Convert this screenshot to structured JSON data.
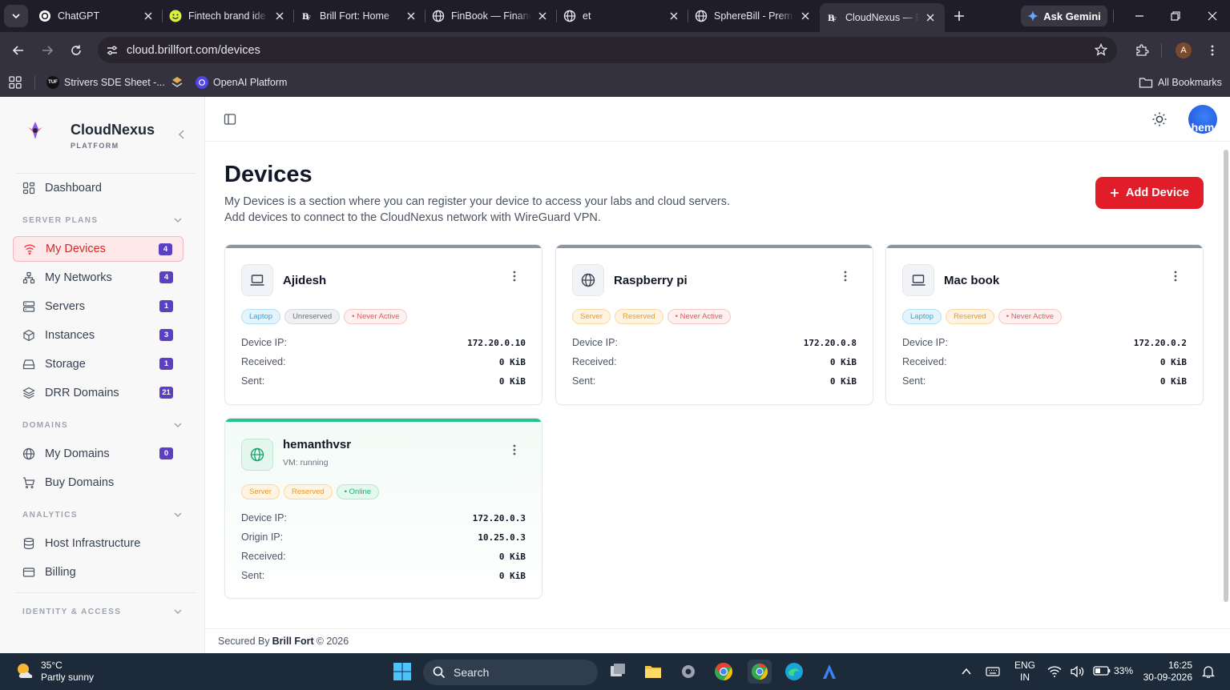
{
  "browser": {
    "tabs": [
      {
        "title": "ChatGPT",
        "icon": "chatgpt-icon"
      },
      {
        "title": "Fintech brand ide",
        "icon": "smiley-icon"
      },
      {
        "title": "Brill Fort: Home",
        "icon": "brillfort-icon"
      },
      {
        "title": "FinBook — Financ",
        "icon": "globe-icon"
      },
      {
        "title": "et",
        "icon": "globe-icon"
      },
      {
        "title": "SphereBill - Prem",
        "icon": "globe-icon"
      },
      {
        "title": "CloudNexus — E",
        "icon": "brillfort-icon",
        "active": true
      }
    ],
    "ask_gemini": "Ask Gemini",
    "url": "cloud.brillfort.com/devices",
    "profile_initial": "A",
    "bookmarks": [
      {
        "label": "Strivers SDE Sheet -...",
        "icon": "tuf-icon"
      },
      {
        "label": "",
        "icon": "bookmark-logo-icon"
      },
      {
        "label": "OpenAI Platform",
        "icon": "openai-icon"
      }
    ],
    "all_bookmarks": "All Bookmarks"
  },
  "sidebar": {
    "brand": "CloudNexus",
    "brand_sub": "PLATFORM",
    "dashboard": "Dashboard",
    "sections": {
      "server_plans": "SERVER PLANS",
      "domains": "DOMAINS",
      "analytics": "ANALYTICS",
      "identity": "IDENTITY & ACCESS"
    },
    "server_items": [
      {
        "label": "My Devices",
        "badge": "4",
        "icon": "wifi-icon"
      },
      {
        "label": "My Networks",
        "badge": "4",
        "icon": "network-icon"
      },
      {
        "label": "Servers",
        "badge": "1",
        "icon": "server-icon"
      },
      {
        "label": "Instances",
        "badge": "3",
        "icon": "cube-icon"
      },
      {
        "label": "Storage",
        "badge": "1",
        "icon": "storage-icon"
      },
      {
        "label": "DRR Domains",
        "badge": "21",
        "icon": "layers-icon"
      }
    ],
    "domain_items": [
      {
        "label": "My Domains",
        "badge": "0",
        "icon": "globe-icon"
      },
      {
        "label": "Buy Domains",
        "icon": "cart-icon"
      }
    ],
    "analytics_items": [
      {
        "label": "Host Infrastructure",
        "icon": "database-icon"
      },
      {
        "label": "Billing",
        "icon": "card-icon"
      }
    ]
  },
  "header": {
    "avatar_text": "hem"
  },
  "main": {
    "title": "Devices",
    "desc_line1": "My Devices is a section where you can register your device to access your labs and cloud servers.",
    "desc_line2": "Add devices to connect to the CloudNexus network with WireGuard VPN.",
    "add_button": "Add Device"
  },
  "devices": [
    {
      "name": "Ajidesh",
      "icon": "laptop-icon",
      "tags": [
        "Laptop",
        "Unreserved",
        "• Never Active"
      ],
      "rows": [
        [
          "Device IP:",
          "172.20.0.10"
        ],
        [
          "Received:",
          "0 KiB"
        ],
        [
          "Sent:",
          "0 KiB"
        ]
      ]
    },
    {
      "name": "Raspberry pi",
      "icon": "globe-icon",
      "tags": [
        "Server",
        "Reserved",
        "• Never Active"
      ],
      "rows": [
        [
          "Device IP:",
          "172.20.0.8"
        ],
        [
          "Received:",
          "0 KiB"
        ],
        [
          "Sent:",
          "0 KiB"
        ]
      ]
    },
    {
      "name": "Mac book",
      "icon": "laptop-icon",
      "tags": [
        "Laptop",
        "Reserved",
        "• Never Active"
      ],
      "rows": [
        [
          "Device IP:",
          "172.20.0.2"
        ],
        [
          "Received:",
          "0 KiB"
        ],
        [
          "Sent:",
          "0 KiB"
        ]
      ]
    },
    {
      "name": "hemanthvsr",
      "sub": "VM: running",
      "icon": "globe-icon",
      "tags": [
        "Server",
        "Reserved",
        "• Online"
      ],
      "rows": [
        [
          "Device IP:",
          "172.20.0.3"
        ],
        [
          "Origin IP:",
          "10.25.0.3"
        ],
        [
          "Received:",
          "0 KiB"
        ],
        [
          "Sent:",
          "0 KiB"
        ]
      ]
    }
  ],
  "footer": {
    "prefix": "Secured By",
    "brand": "Brill Fort",
    "suffix": "© 2026"
  },
  "taskbar": {
    "weather_temp": "35°C",
    "weather_desc": "Partly sunny",
    "search": "Search",
    "lang1": "ENG",
    "lang2": "IN",
    "battery": "33%",
    "time": "16:25",
    "date": "30-09-2026"
  },
  "colors": {
    "accent": "#e11d2a",
    "badge": "#5b3fc4",
    "online": "#22c48a"
  }
}
